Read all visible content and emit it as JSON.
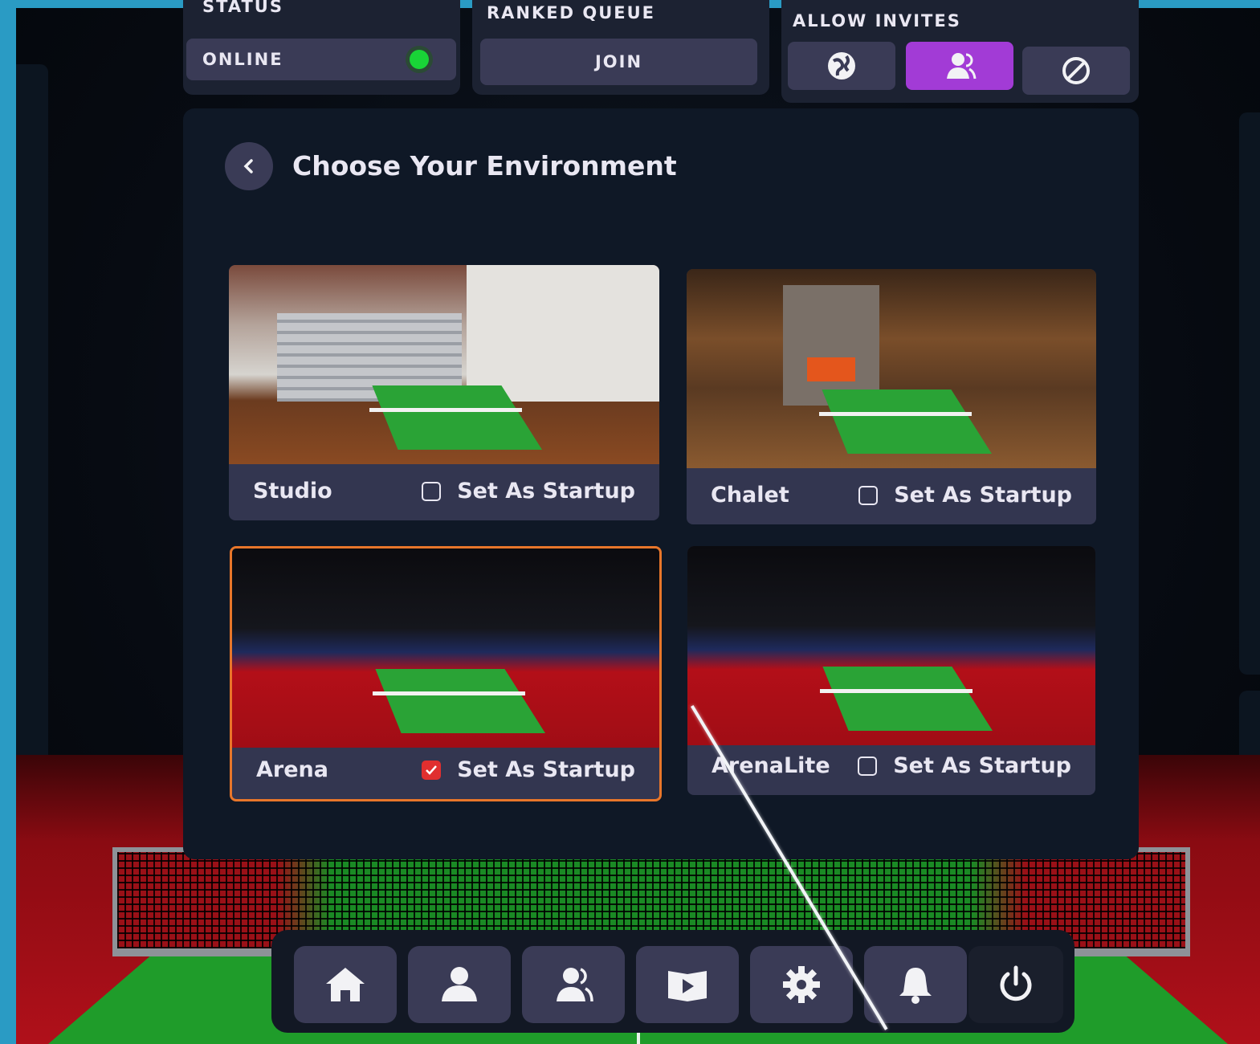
{
  "topbar": {
    "status_label": "STATUS",
    "status_value": "ONLINE",
    "status_color": "#19d437",
    "queue_label": "RANKED QUEUE",
    "join_label": "JOIN",
    "invites_label": "ALLOW INVITES",
    "invite_options": [
      {
        "icon": "globe-icon",
        "active": false
      },
      {
        "icon": "friends-icon",
        "active": true
      },
      {
        "icon": "blocked-icon",
        "active": false
      }
    ]
  },
  "panel": {
    "title": "Choose Your Environment",
    "environments": [
      {
        "name": "Studio",
        "startup_label": "Set As Startup",
        "startup": false,
        "selected": false
      },
      {
        "name": "Chalet",
        "startup_label": "Set As Startup",
        "startup": false,
        "selected": false
      },
      {
        "name": "Arena",
        "startup_label": "Set As Startup",
        "startup": true,
        "selected": true
      },
      {
        "name": "ArenaLite",
        "startup_label": "Set As Startup",
        "startup": false,
        "selected": false
      }
    ]
  },
  "dock": {
    "items": [
      "home-icon",
      "profile-icon",
      "friends-icon",
      "tutorial-icon",
      "settings-icon",
      "notifications-icon",
      "power-icon"
    ]
  },
  "colors": {
    "accent_purple": "#a23bd6",
    "selected_border": "#e8762a",
    "checkbox_checked": "#e02f2f"
  }
}
